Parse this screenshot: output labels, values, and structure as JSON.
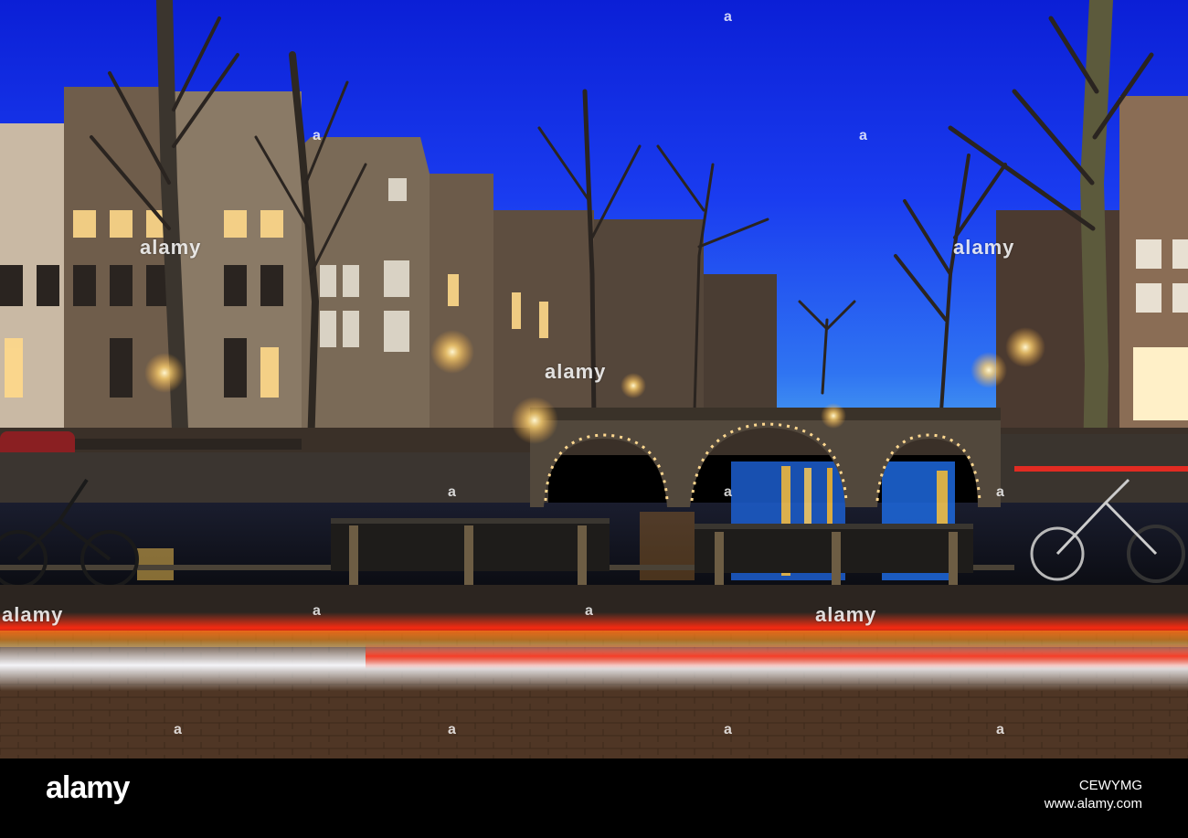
{
  "footer": {
    "brand": "alamy",
    "image_id": "CEWYMG",
    "url": "www.alamy.com"
  },
  "watermark": {
    "text": "alamy",
    "mark": "a"
  }
}
